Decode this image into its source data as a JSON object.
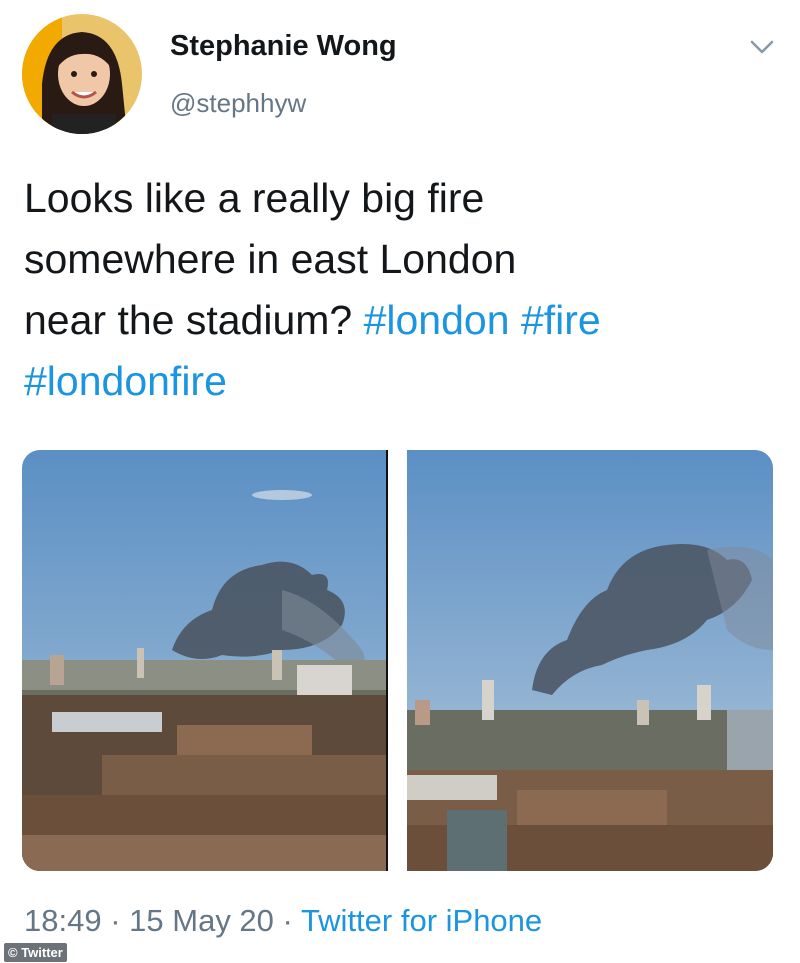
{
  "user": {
    "display_name": "Stephanie Wong",
    "handle": "@stephhyw"
  },
  "tweet": {
    "text_line1": "Looks like a really big fire",
    "text_line2": "somewhere in east London",
    "text_line3_prefix": "near the stadium? ",
    "hashtags": [
      "#london",
      "#fire",
      "#londonfire"
    ]
  },
  "media": [
    {
      "kind": "photo",
      "subject": "smoke plume over city skyline"
    },
    {
      "kind": "photo",
      "subject": "smoke plume over city skyline"
    }
  ],
  "footer": {
    "time": "18:49",
    "separator": "·",
    "date": "15 May 20",
    "source": "Twitter for iPhone"
  },
  "watermark": "© Twitter",
  "icons": {
    "menu": "chevron-down-icon"
  },
  "colors": {
    "link": "#1b95e0",
    "muted": "#657786",
    "text": "#14171a"
  }
}
